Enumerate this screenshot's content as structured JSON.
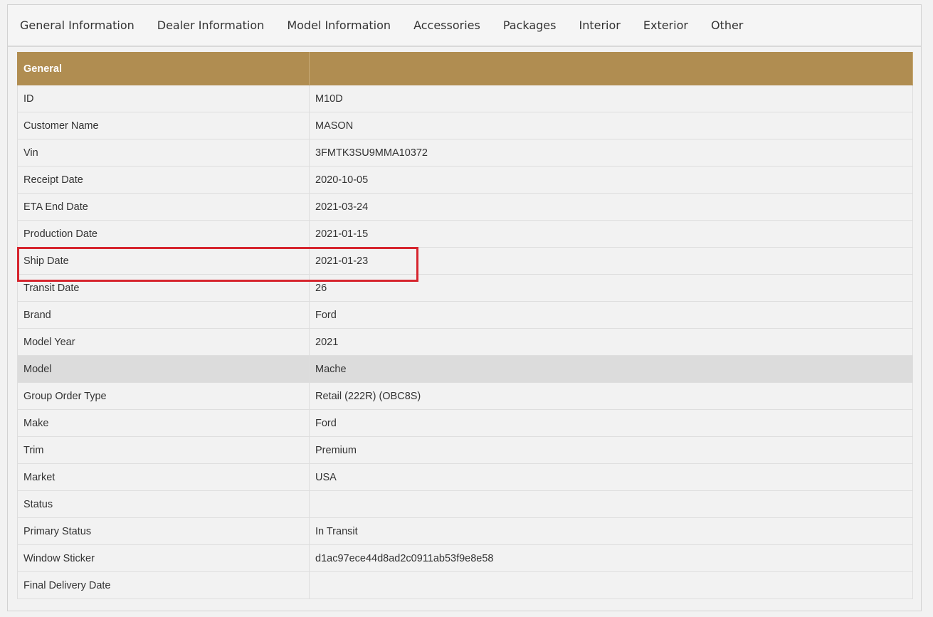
{
  "tabs": [
    {
      "label": "General Information"
    },
    {
      "label": "Dealer Information"
    },
    {
      "label": "Model Information"
    },
    {
      "label": "Accessories"
    },
    {
      "label": "Packages"
    },
    {
      "label": "Interior"
    },
    {
      "label": "Exterior"
    },
    {
      "label": "Other"
    }
  ],
  "table": {
    "header": {
      "label": "General",
      "value": ""
    },
    "rows": [
      {
        "label": "ID",
        "value": "M10D"
      },
      {
        "label": "Customer Name",
        "value": "MASON"
      },
      {
        "label": "Vin",
        "value": "3FMTK3SU9MMA10372"
      },
      {
        "label": "Receipt Date",
        "value": "2020-10-05"
      },
      {
        "label": "ETA End Date",
        "value": "2021-03-24"
      },
      {
        "label": "Production Date",
        "value": "2021-01-15"
      },
      {
        "label": "Ship Date",
        "value": "2021-01-23"
      },
      {
        "label": "Transit Date",
        "value": "26"
      },
      {
        "label": "Brand",
        "value": "Ford"
      },
      {
        "label": "Model Year",
        "value": "2021"
      },
      {
        "label": "Model",
        "value": "Mache"
      },
      {
        "label": "Group Order Type",
        "value": "Retail (222R) (OBC8S)"
      },
      {
        "label": "Make",
        "value": "Ford"
      },
      {
        "label": "Trim",
        "value": "Premium"
      },
      {
        "label": "Market",
        "value": "USA"
      },
      {
        "label": "Status",
        "value": ""
      },
      {
        "label": "Primary Status",
        "value": "In Transit"
      },
      {
        "label": "Window Sticker",
        "value": "d1ac97ece44d8ad2c0911ab53f9e8e58"
      },
      {
        "label": "Final Delivery Date",
        "value": ""
      }
    ]
  },
  "colors": {
    "header_bg": "#b08d51",
    "highlight_border": "#d6252e",
    "hover_row_bg": "#dcdcdc"
  }
}
